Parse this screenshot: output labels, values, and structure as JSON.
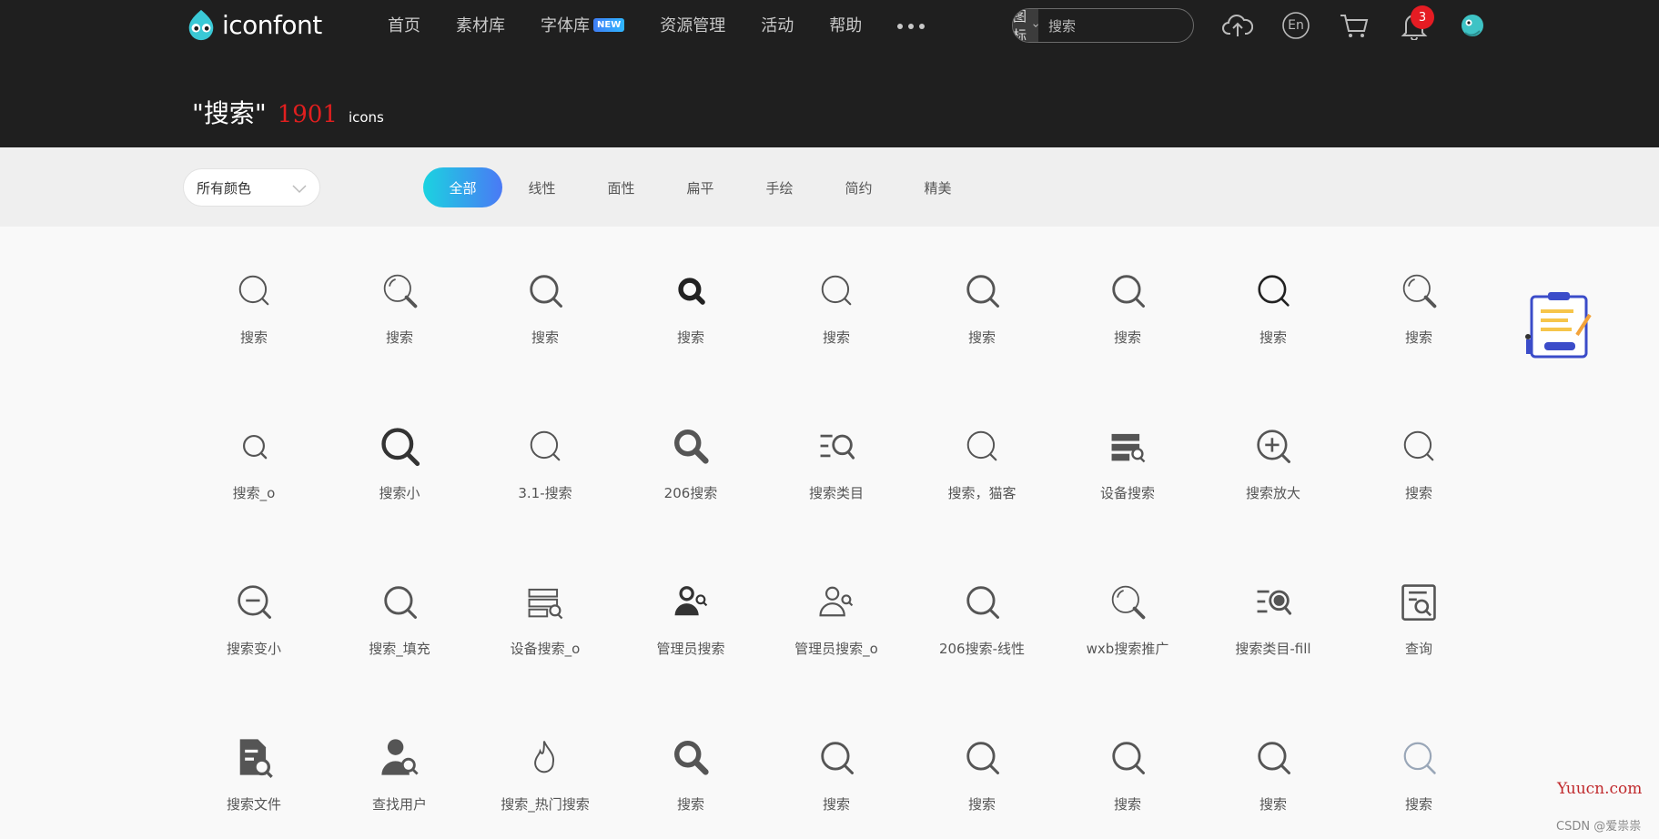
{
  "header": {
    "logo_text": "iconfont",
    "nav": [
      {
        "label": "首页",
        "icon": "",
        "badge": ""
      },
      {
        "label": "素材库",
        "icon": "",
        "badge": ""
      },
      {
        "label": "字体库",
        "icon": "",
        "badge": "NEW"
      },
      {
        "label": "资源管理",
        "icon": "",
        "badge": ""
      },
      {
        "label": "活动",
        "icon": "",
        "badge": ""
      },
      {
        "label": "帮助",
        "icon": "",
        "badge": ""
      }
    ],
    "more_icon": "more-dots-icon",
    "search": {
      "type_label": "图标",
      "value": "搜索"
    },
    "notifications_count": "3",
    "lang_label": "En"
  },
  "result": {
    "query": "\"搜索\"",
    "count": "1901",
    "unit": "icons"
  },
  "filters": {
    "color_select": "所有颜色",
    "tabs": [
      "全部",
      "线性",
      "面性",
      "扁平",
      "手绘",
      "简约",
      "精美"
    ],
    "active_tab": "全部"
  },
  "colors": {
    "header_bg": "#1f1f1f",
    "accent_gradient_start": "#1bd3e0",
    "accent_gradient_end": "#4a79f5",
    "count_red": "#e11f1f",
    "badge_red": "#e51c23"
  },
  "icons": [
    {
      "label": "搜索",
      "icon": "search-thin-icon"
    },
    {
      "label": "搜索",
      "icon": "search-highlight-icon"
    },
    {
      "label": "搜索",
      "icon": "search-icon"
    },
    {
      "label": "搜索",
      "icon": "search-bold-icon"
    },
    {
      "label": "搜索",
      "icon": "search-thin-icon"
    },
    {
      "label": "搜索",
      "icon": "search-icon"
    },
    {
      "label": "搜索",
      "icon": "search-icon"
    },
    {
      "label": "搜索",
      "icon": "search-dark-icon"
    },
    {
      "label": "搜索",
      "icon": "search-highlight-icon"
    },
    {
      "label": "搜索_o",
      "icon": "search-small-icon"
    },
    {
      "label": "搜索小",
      "icon": "search-heavy-icon"
    },
    {
      "label": "3.1-搜索",
      "icon": "search-thin-icon"
    },
    {
      "label": "206搜索",
      "icon": "search-filled-icon"
    },
    {
      "label": "搜索类目",
      "icon": "search-list-icon"
    },
    {
      "label": "搜索，猫客",
      "icon": "search-thin-icon"
    },
    {
      "label": "设备搜索",
      "icon": "device-search-fill-icon"
    },
    {
      "label": "搜索放大",
      "icon": "zoom-in-icon"
    },
    {
      "label": "搜索",
      "icon": "search-thin-icon"
    },
    {
      "label": "搜索变小",
      "icon": "zoom-out-icon"
    },
    {
      "label": "搜索_填充",
      "icon": "search-icon"
    },
    {
      "label": "设备搜索_o",
      "icon": "device-search-icon"
    },
    {
      "label": "管理员搜索",
      "icon": "admin-search-fill-icon"
    },
    {
      "label": "管理员搜索_o",
      "icon": "admin-search-icon"
    },
    {
      "label": "206搜索-线性",
      "icon": "search-icon"
    },
    {
      "label": "wxb搜索推广",
      "icon": "search-highlight-icon"
    },
    {
      "label": "搜索类目-fill",
      "icon": "search-list-fill-icon"
    },
    {
      "label": "查询",
      "icon": "query-doc-icon"
    },
    {
      "label": "搜索文件",
      "icon": "file-search-icon"
    },
    {
      "label": "查找用户",
      "icon": "user-search-icon"
    },
    {
      "label": "搜索_热门搜索",
      "icon": "hot-search-icon"
    },
    {
      "label": "搜索",
      "icon": "search-filled-icon"
    },
    {
      "label": "搜索",
      "icon": "search-icon"
    },
    {
      "label": "搜索",
      "icon": "search-icon"
    },
    {
      "label": "搜索",
      "icon": "search-icon"
    },
    {
      "label": "搜索",
      "icon": "search-icon"
    },
    {
      "label": "搜索",
      "icon": "search-light-icon"
    }
  ],
  "watermark": "Yuucn.com",
  "csdn_credit": "CSDN @爱祟祟"
}
